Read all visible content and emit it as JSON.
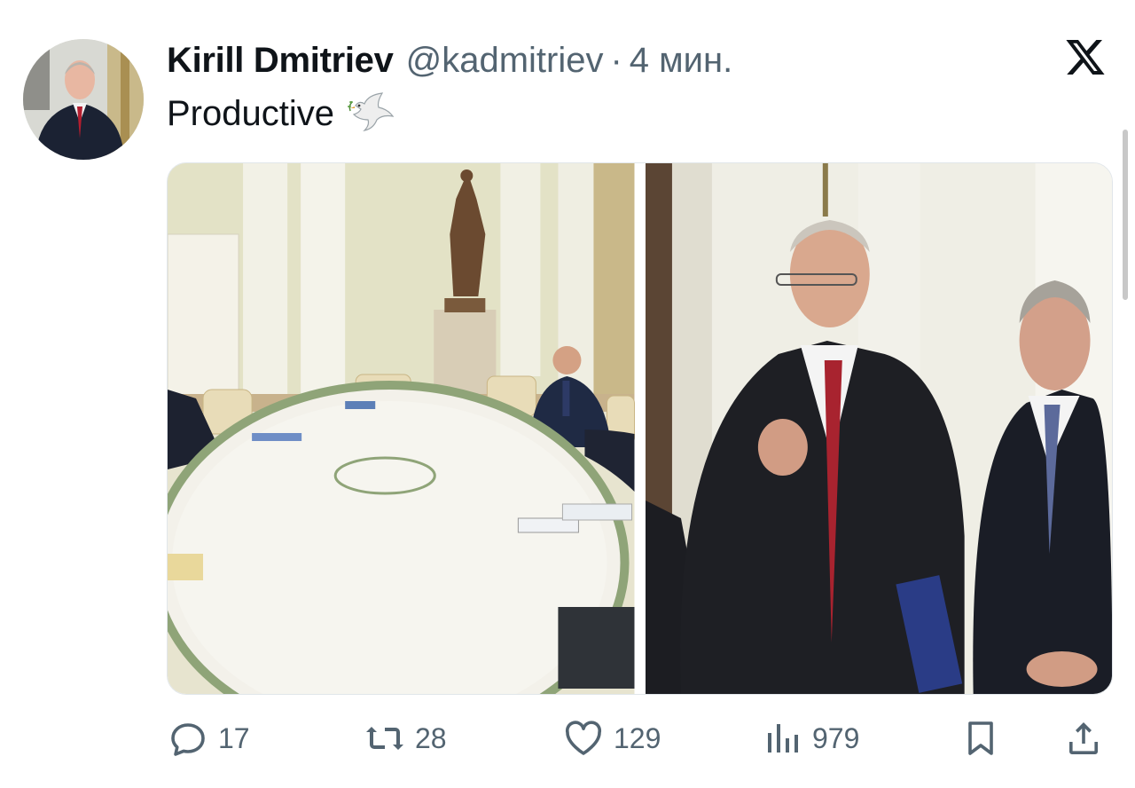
{
  "author": {
    "name": "Kirill Dmitriev",
    "handle": "@kadmitriev",
    "separator": "·",
    "time": "4 мин."
  },
  "tweet": {
    "text": "Productive",
    "emoji": "dove-icon"
  },
  "actions": {
    "replies": "17",
    "retweets": "28",
    "likes": "129",
    "views": "979"
  },
  "colors": {
    "text": "#0f1419",
    "secondary": "#536471"
  }
}
